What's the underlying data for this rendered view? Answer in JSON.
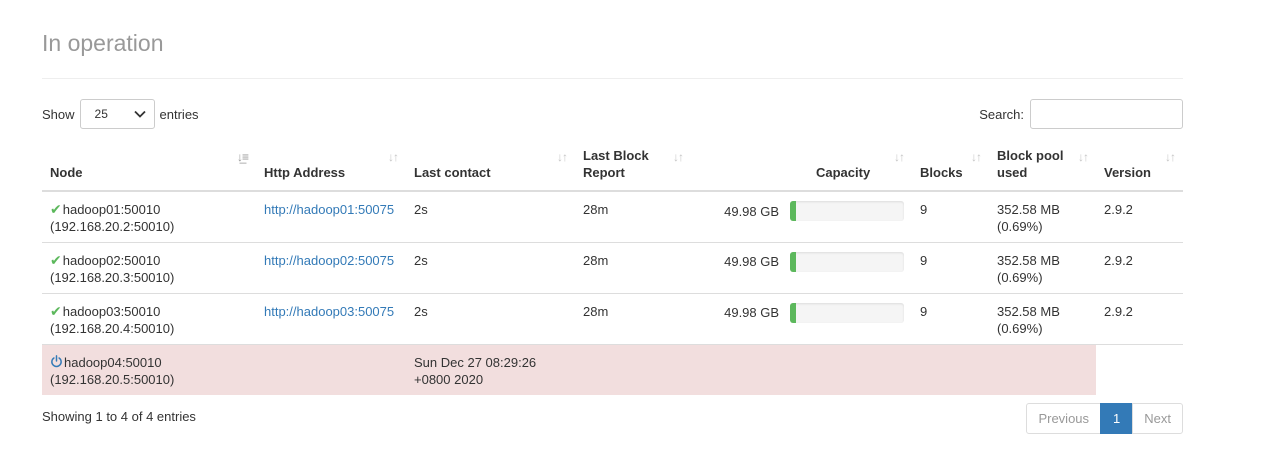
{
  "page": {
    "title": "In operation"
  },
  "controls": {
    "show_label": "Show",
    "entries_label": "entries",
    "page_length": "25",
    "search_label": "Search:",
    "search_value": ""
  },
  "table": {
    "headers": {
      "node": "Node",
      "http": "Http Address",
      "last_contact": "Last contact",
      "last_block_report": "Last Block Report",
      "capacity": "Capacity",
      "blocks": "Blocks",
      "block_pool_used": "Block pool used",
      "version": "Version"
    },
    "rows": [
      {
        "status": "in-service",
        "status_icon": "check-icon",
        "node": "hadoop01:50010",
        "node_ip": "(192.168.20.2:50010)",
        "http": "http://hadoop01:50075",
        "last_contact": "2s",
        "last_block_report": "28m",
        "capacity": "49.98 GB",
        "capacity_used_fraction": 0.0069,
        "blocks": "9",
        "block_pool_used": "352.58 MB",
        "block_pool_pct": "(0.69%)",
        "version": "2.9.2"
      },
      {
        "status": "in-service",
        "status_icon": "check-icon",
        "node": "hadoop02:50010",
        "node_ip": "(192.168.20.3:50010)",
        "http": "http://hadoop02:50075",
        "last_contact": "2s",
        "last_block_report": "28m",
        "capacity": "49.98 GB",
        "capacity_used_fraction": 0.0069,
        "blocks": "9",
        "block_pool_used": "352.58 MB",
        "block_pool_pct": "(0.69%)",
        "version": "2.9.2"
      },
      {
        "status": "in-service",
        "status_icon": "check-icon",
        "node": "hadoop03:50010",
        "node_ip": "(192.168.20.4:50010)",
        "http": "http://hadoop03:50075",
        "last_contact": "2s",
        "last_block_report": "28m",
        "capacity": "49.98 GB",
        "capacity_used_fraction": 0.0069,
        "blocks": "9",
        "block_pool_used": "352.58 MB",
        "block_pool_pct": "(0.69%)",
        "version": "2.9.2"
      },
      {
        "status": "dead",
        "status_icon": "power-icon",
        "node": "hadoop04:50010",
        "node_ip": "(192.168.20.5:50010)",
        "last_contact_line1": "Sun Dec 27 08:29:26",
        "last_contact_line2": "+0800 2020"
      }
    ]
  },
  "footer": {
    "info": "Showing 1 to 4 of 4 entries",
    "previous": "Previous",
    "current_page": "1",
    "next": "Next"
  },
  "colors": {
    "ok_green": "#5cb85c",
    "dead_row_bg": "#f2dede",
    "link_blue": "#337ab7",
    "active_page": "#337ab7"
  }
}
